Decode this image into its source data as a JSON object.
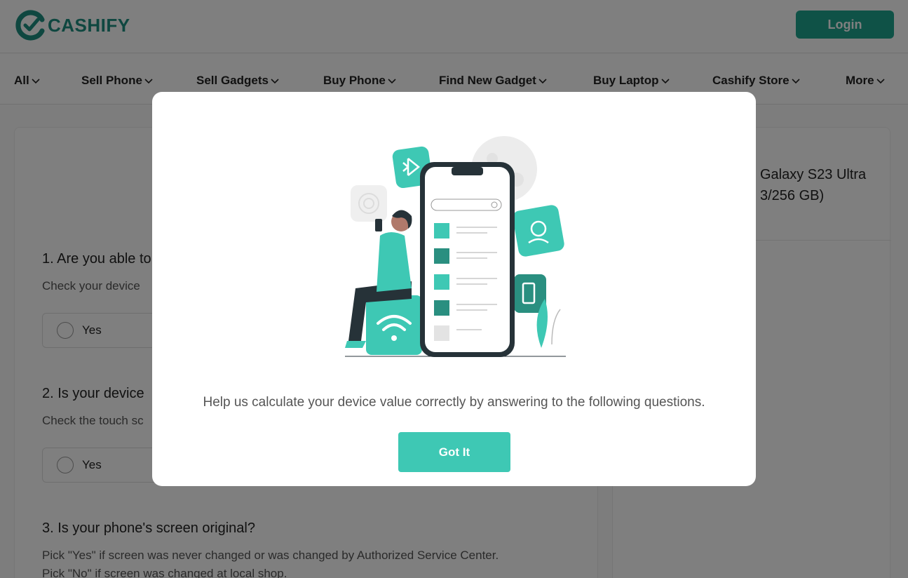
{
  "header": {
    "logo_text": "CASHIFY",
    "login_label": "Login"
  },
  "nav": {
    "items": [
      "All",
      "Sell Phone",
      "Sell Gadgets",
      "Buy Phone",
      "Find New Gadget",
      "Buy Laptop",
      "Cashify Store",
      "More"
    ]
  },
  "device": {
    "name_line1": "Galaxy S23 Ultra",
    "name_line2": "3/256 GB)"
  },
  "questions": [
    {
      "title": "1. Are you able to",
      "subtitle": "Check your device",
      "option": "Yes"
    },
    {
      "title": "2. Is your device",
      "subtitle": "Check the touch sc",
      "option": "Yes"
    },
    {
      "title": "3. Is your phone's screen original?",
      "subtitle": "Pick \"Yes\" if screen was never changed or was changed by Authorized Service Center.",
      "subtitle2": "Pick \"No\" if screen was changed at local shop."
    }
  ],
  "modal": {
    "message": "Help us calculate your device value correctly by answering to the following questions.",
    "button_label": "Got It"
  },
  "colors": {
    "brand": "#1fa58f",
    "accent": "#3ec8b4",
    "dark_teal": "#2a8f80"
  },
  "icons": [
    "logo-icon",
    "chevron-down-icon",
    "phone-illustration",
    "bluetooth-icon",
    "fingerprint-icon",
    "face-id-icon",
    "battery-icon",
    "wifi-icon",
    "search-icon"
  ]
}
